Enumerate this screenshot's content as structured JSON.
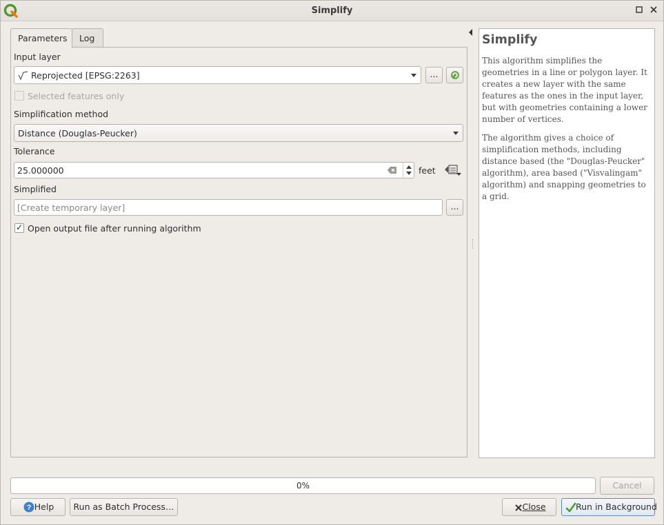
{
  "window": {
    "title": "Simplify"
  },
  "tabs": [
    {
      "label": "Parameters"
    },
    {
      "label": "Log"
    }
  ],
  "form": {
    "input_layer": {
      "label": "Input layer",
      "value": "Reprojected [EPSG:2263]",
      "browse": "..."
    },
    "selected_only": {
      "label": "Selected features only",
      "checked": false
    },
    "method": {
      "label": "Simplification method",
      "value": "Distance (Douglas-Peucker)"
    },
    "tolerance": {
      "label": "Tolerance",
      "value": "25.000000",
      "unit": "feet"
    },
    "simplified": {
      "label": "Simplified",
      "placeholder": "[Create temporary layer]",
      "browse": "..."
    },
    "open_output": {
      "label": "Open output file after running algorithm",
      "checked": true
    }
  },
  "help": {
    "title": "Simplify",
    "paragraphs": [
      "This algorithm simplifies the geometries in a line or polygon layer. It creates a new layer with the same features as the ones in the input layer, but with geometries containing a lower number of vertices.",
      "The algorithm gives a choice of simplification methods, including distance based (the \"Douglas-Peucker\" algorithm), area based (\"Visvalingam\" algorithm) and snapping geometries to a grid."
    ]
  },
  "progress": {
    "text": "0%",
    "value": 0
  },
  "buttons": {
    "cancel": "Cancel",
    "help": "Help",
    "batch": "Run as Batch Process…",
    "close": "Close",
    "run": "Run in Background"
  },
  "colors": {
    "accent": "#5c89b7",
    "logo_green": "#589632",
    "logo_yellow": "#ee7913"
  }
}
